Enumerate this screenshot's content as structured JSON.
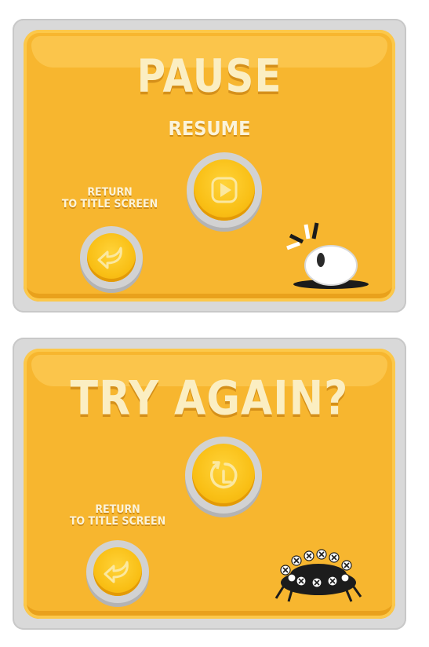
{
  "pause_panel": {
    "title": "PAUSE",
    "resume_label": "RESUME",
    "return_label_line1": "RETURN",
    "return_label_line2": "TO TITLE SCREEN"
  },
  "try_again_panel": {
    "title": "TRY AGAIN?",
    "return_label_line1": "RETURN",
    "return_label_line2": "TO TITLE SCREEN"
  },
  "icons": {
    "resume": "play-icon",
    "retry": "retry-icon",
    "return": "back-arrow-icon"
  },
  "colors": {
    "panel": "#f7b62f",
    "button_face": "#f9bf15",
    "button_ring": "#d2d2d2",
    "title_text": "#fbeec2"
  }
}
